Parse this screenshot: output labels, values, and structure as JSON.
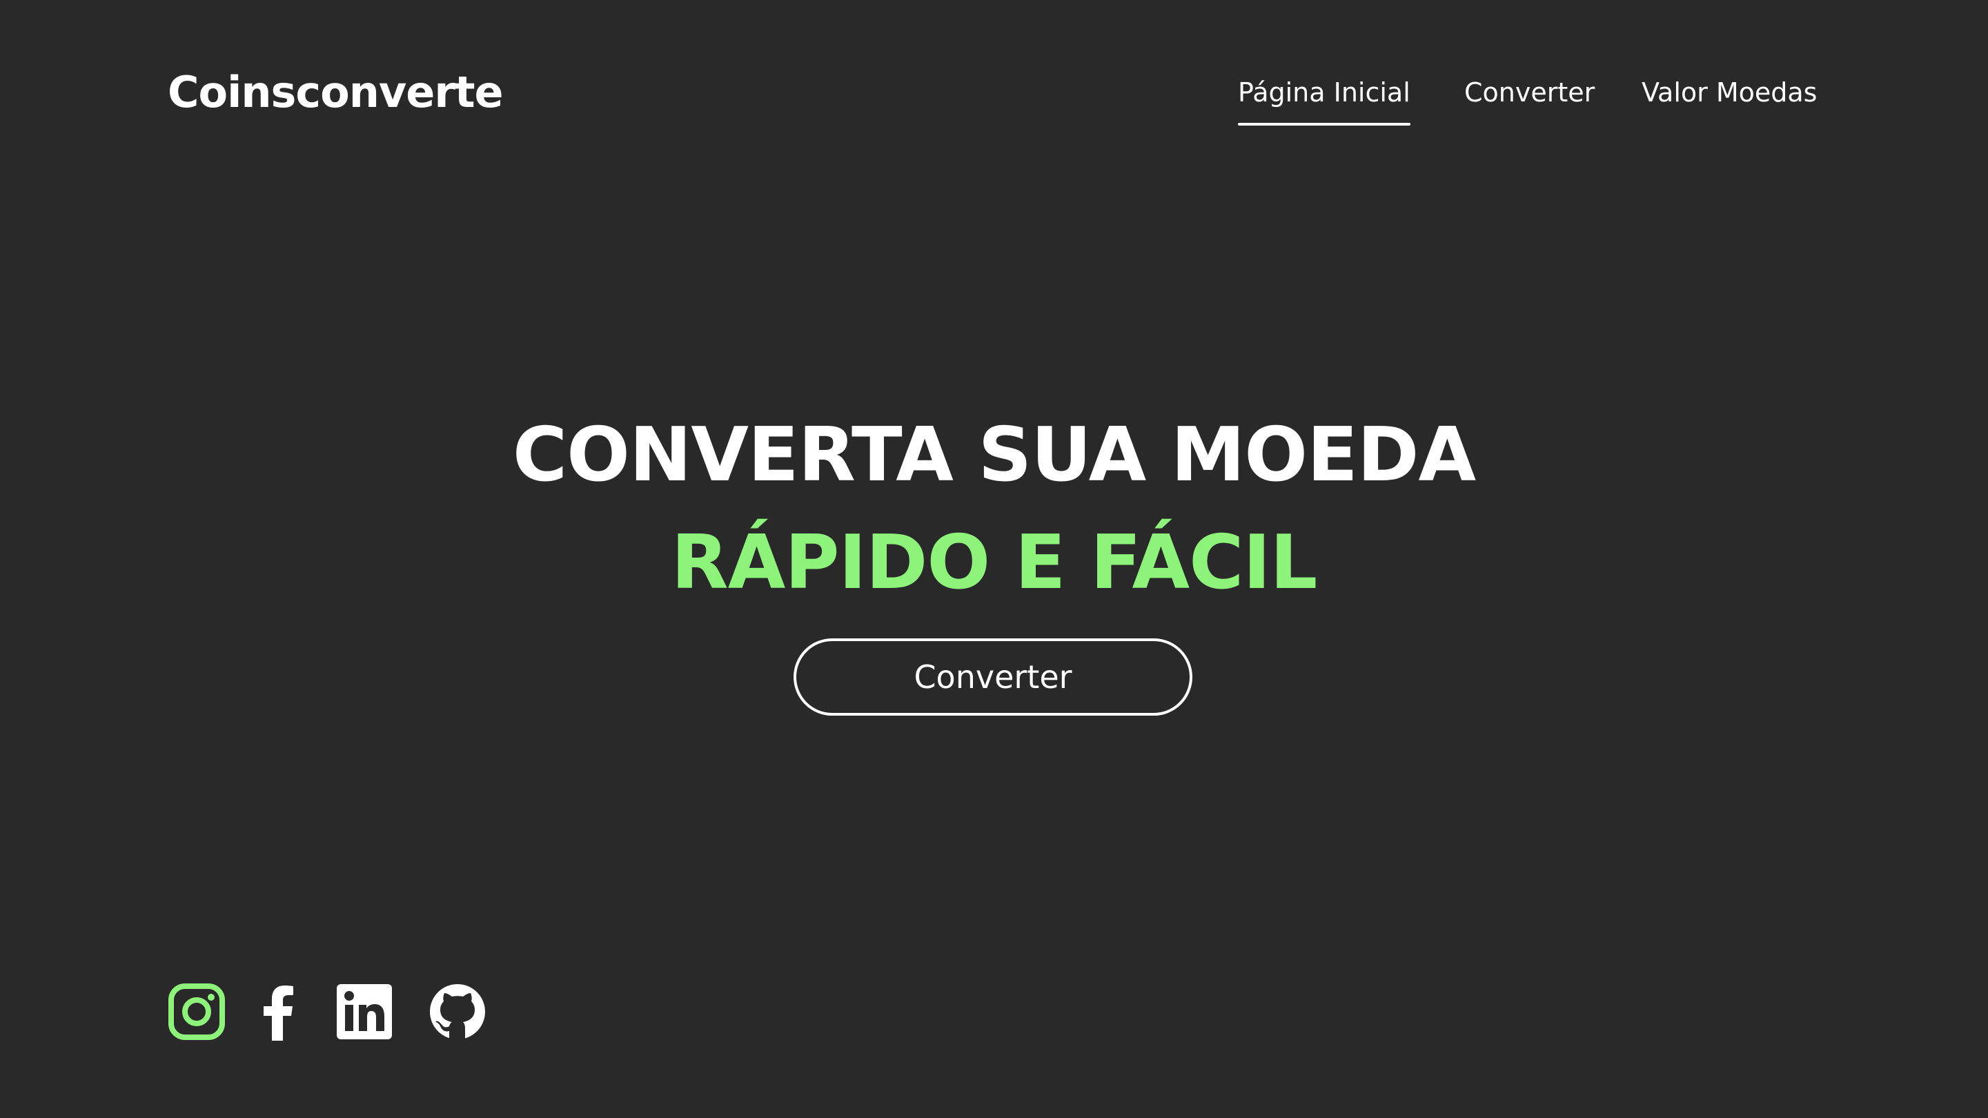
{
  "header": {
    "logo": "Coinsconverte",
    "nav": [
      {
        "label": "Página Inicial",
        "active": true
      },
      {
        "label": "Converter",
        "active": false
      },
      {
        "label": "Valor Moedas",
        "active": false
      }
    ]
  },
  "hero": {
    "title": "CONVERTA SUA MOEDA",
    "subtitle": "RÁPIDO E FÁCIL",
    "cta_label": "Converter"
  },
  "socials": [
    {
      "icon": "instagram-icon",
      "color": "#8ef37a"
    },
    {
      "icon": "facebook-icon",
      "color": "#ffffff"
    },
    {
      "icon": "linkedin-icon",
      "color": "#ffffff"
    },
    {
      "icon": "github-icon",
      "color": "#ffffff"
    }
  ],
  "colors": {
    "background": "#292929",
    "accent": "#8ef37a",
    "text": "#ffffff"
  }
}
